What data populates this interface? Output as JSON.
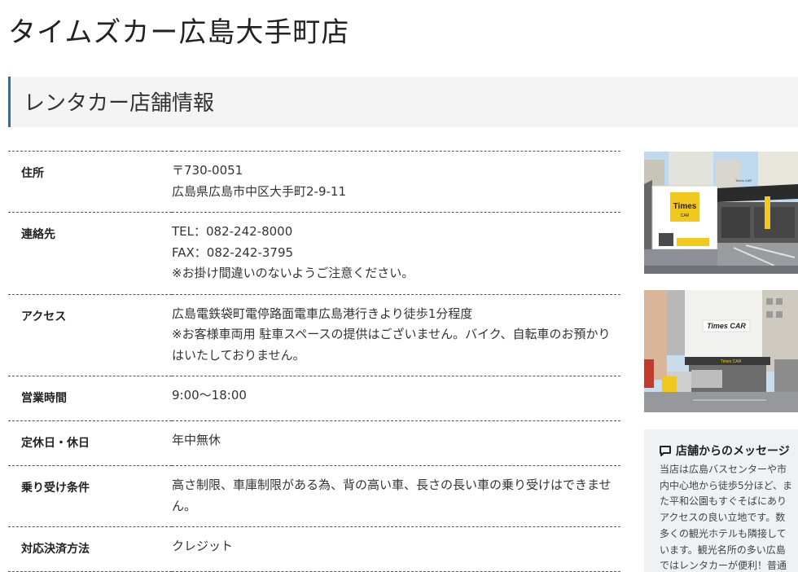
{
  "store": {
    "name": "タイムズカー広島大手町店"
  },
  "section": {
    "heading": "レンタカー店舗情報"
  },
  "info": {
    "address": {
      "label": "住所",
      "lines": [
        "〒730-0051",
        "広島県広島市中区大手町2-9-11"
      ]
    },
    "contact": {
      "label": "連絡先",
      "lines": [
        "TEL：082-242-8000",
        "FAX：082-242-3795",
        "※お掛け間違いのないようご注意ください。"
      ]
    },
    "access": {
      "label": "アクセス",
      "lines": [
        "広島電鉄袋町電停路面電車広島港行きより徒歩1分程度",
        "※お客様車両用 駐車スペースの提供はございません。バイク、自転車のお預かり",
        "はいたしておりません。"
      ]
    },
    "hours": {
      "label": "営業時間",
      "value": "9:00〜18:00"
    },
    "holiday": {
      "label": "定休日・休日",
      "value": "年中無休"
    },
    "conditions": {
      "label": "乗り受け条件",
      "lines": [
        "高さ制限、車庫制限がある為、背の高い車、長さの長い車の乗り受けはできませ",
        "ん。"
      ]
    },
    "payment": {
      "label": "対応決済方法",
      "value": "クレジット"
    }
  },
  "photos": {
    "photo1": {
      "sign": "Times",
      "sign_sub": "CAR",
      "canopy_sign": "Times CAR"
    },
    "photo2": {
      "sign": "Times CAR",
      "canopy_sign": "Times CAR"
    }
  },
  "message": {
    "title": "店舗からのメッセージ",
    "lines": [
      "当店は広島バスセンターや市",
      "内中心地から徒歩5分ほど、ま",
      "た平和公園もすぐそばにあり",
      "アクセスの良い立地です。数",
      "多くの観光ホテルも隣接して",
      "います。観光名所の多い広島",
      "ではレンタカーが便利！普通"
    ]
  },
  "colors": {
    "accent": "#3d6a8c",
    "brand_yellow": "#f2c81e",
    "heading_bg": "#f4f4f4",
    "message_bg": "#eef2f4"
  }
}
